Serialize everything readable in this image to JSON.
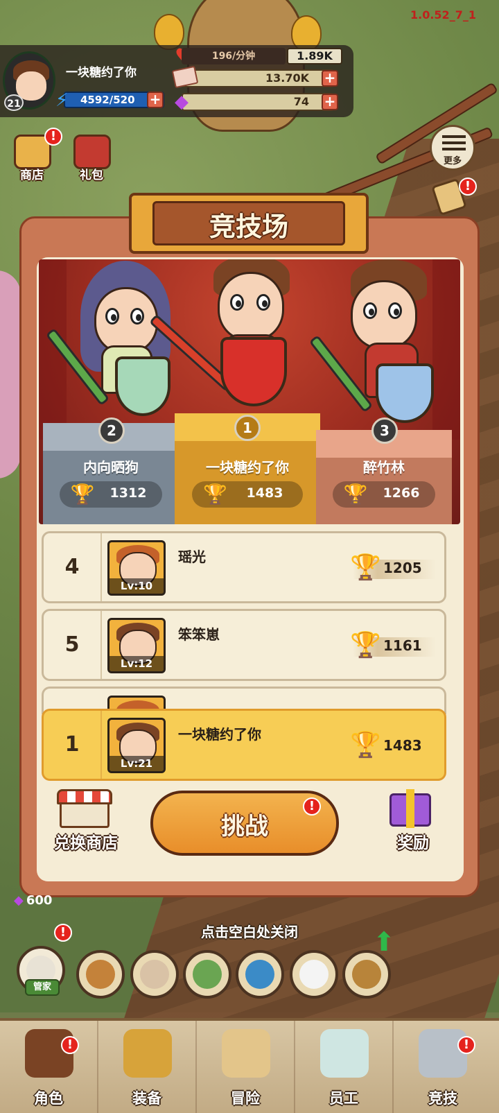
{
  "version": "1.0.52_7_1",
  "player": {
    "name": "一块糖约了你",
    "level": "21",
    "energy": "4592/520"
  },
  "resources": {
    "rate": "196/分钟",
    "rate_total": "1.89K",
    "cash": "13.70K",
    "gems": "74"
  },
  "top_buttons": {
    "shop_label": "商店",
    "gift_label": "礼包",
    "more_label": "更多",
    "badge": "!"
  },
  "arena": {
    "title": "竞技场",
    "podium": [
      {
        "rank": "2",
        "name": "内向晒狗",
        "score": "1312"
      },
      {
        "rank": "1",
        "name": "一块糖约了你",
        "score": "1483"
      },
      {
        "rank": "3",
        "name": "醉竹林",
        "score": "1266"
      }
    ],
    "rows": [
      {
        "rank": "4",
        "name": "瑶光",
        "level": "Lv:10",
        "score": "1205"
      },
      {
        "rank": "5",
        "name": "笨笨崽",
        "level": "Lv:12",
        "score": "1161"
      }
    ],
    "me": {
      "rank": "1",
      "name": "一块糖约了你",
      "level": "Lv:21",
      "score": "1483"
    },
    "exchange_label": "兑换商店",
    "challenge_label": "挑战",
    "reward_label": "奖励"
  },
  "gem_floor": "600",
  "close_hint": "点击空白处关闭",
  "butler_label": "管家",
  "nav": [
    {
      "label": "角色"
    },
    {
      "label": "装备"
    },
    {
      "label": "冒险"
    },
    {
      "label": "员工"
    },
    {
      "label": "竞技"
    }
  ],
  "colors": {
    "panel": "#c97855",
    "accent_gold": "#f7cd55",
    "badge_red": "#e5231d"
  }
}
